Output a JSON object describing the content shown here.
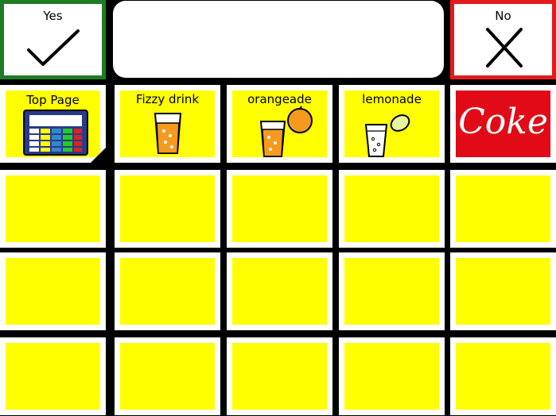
{
  "top_bar": {
    "yes_label": "Yes",
    "no_label": "No",
    "message_text": ""
  },
  "row1": {
    "top_page_label": "Top Page",
    "fizzy_label": "Fizzy drink",
    "orangeade_label": "orangeade",
    "lemonade_label": "lemonade",
    "coke_label": "Coke"
  },
  "colors": {
    "yes_border": "#1e7d22",
    "no_border": "#e31b1b",
    "tile_yellow": "#ffff00",
    "coke_red": "#e10a16",
    "background": "#000000"
  },
  "icons": [
    "check-icon",
    "cross-icon",
    "grid-icon",
    "glass-icon",
    "orange-icon",
    "lemon-icon"
  ]
}
